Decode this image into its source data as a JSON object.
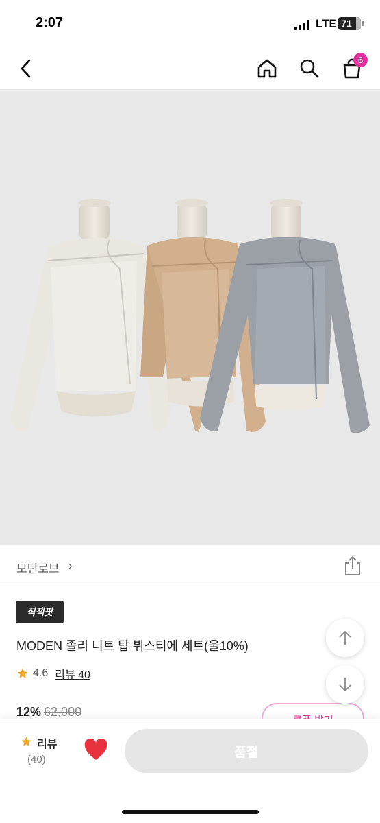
{
  "status": {
    "time": "2:07",
    "network": "LTE",
    "battery": "71"
  },
  "nav": {
    "cart_count": "6"
  },
  "brand": {
    "name": "모던로브",
    "chevron": "›"
  },
  "product": {
    "badge": "직잭팟",
    "title": "MODEN 졸리 니트 탑 뷔스티에 세트(울10%)",
    "rating": "4.6",
    "review_link": "리뷰 40",
    "discount": "12%",
    "original_price": "62,000",
    "coupon_label": "쿠폰 받기"
  },
  "bottom_bar": {
    "review_label": "리뷰",
    "review_count": "(40)",
    "soldout_label": "품절"
  },
  "colors": {
    "accent": "#e0319e",
    "star": "#f5a623",
    "heart": "#e8333e"
  },
  "icons": [
    "back-icon",
    "home-icon",
    "search-icon",
    "cart-icon",
    "share-icon",
    "arrow-up-icon",
    "arrow-down-icon",
    "star-icon",
    "heart-icon"
  ]
}
